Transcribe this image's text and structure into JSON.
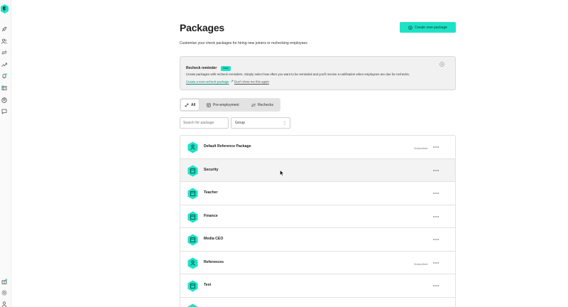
{
  "header": {
    "title": "Packages",
    "subtitle": "Customise your check packages for hiring new joiners or rechecking employees",
    "create_label": "Create new package"
  },
  "reminder": {
    "title": "Recheck reminder",
    "badge": "New",
    "text": "Create packages with recheck reminders. Simply select how often you want to be reminded and you'll receive a notification when employees are due for rechecks.",
    "create_link": "Create a new recheck package",
    "dismiss_link": "Don't show me this again"
  },
  "tabs": [
    {
      "label": "All",
      "active": true
    },
    {
      "label": "Pre-employment",
      "active": false
    },
    {
      "label": "Rechecks",
      "active": false
    }
  ],
  "filters": {
    "search_placeholder": "Search for package",
    "group_value": "Group"
  },
  "packages": [
    {
      "name": "Default Reference Package",
      "status": "Subscribed",
      "icon": "reference-icon"
    },
    {
      "name": "Security",
      "status": "",
      "icon": "package-icon"
    },
    {
      "name": "Teacher",
      "status": "",
      "icon": "package-icon"
    },
    {
      "name": "Finance",
      "status": "",
      "icon": "package-icon"
    },
    {
      "name": "Media CEO",
      "status": "",
      "icon": "package-icon"
    },
    {
      "name": "References",
      "status": "Subscribed",
      "icon": "reference-icon"
    },
    {
      "name": "Test",
      "status": "",
      "icon": "package-icon"
    },
    {
      "name": "",
      "status": "",
      "icon": "package-icon"
    }
  ],
  "colors": {
    "accent": "#1ee2c6",
    "accent_text": "#0b3b34",
    "link": "#0b8a78"
  }
}
